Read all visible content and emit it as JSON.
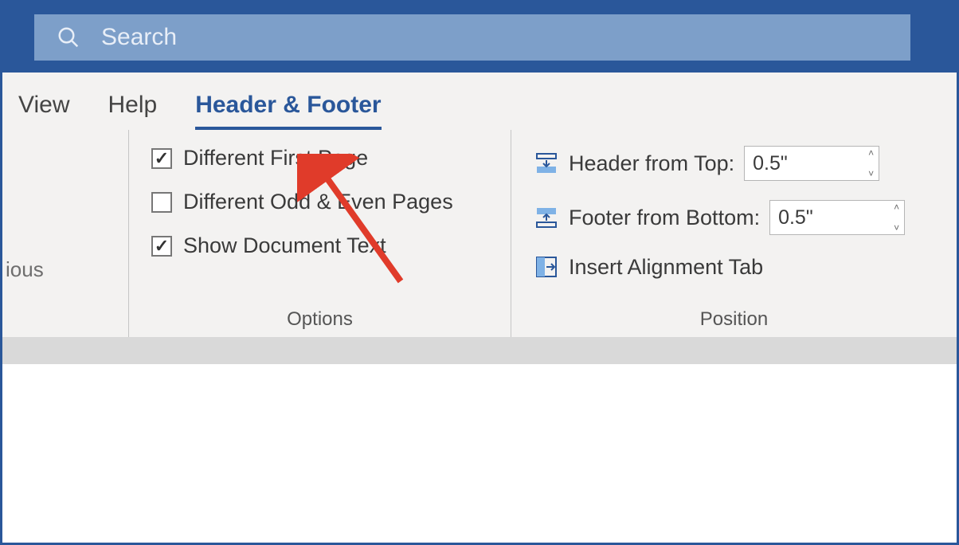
{
  "search": {
    "placeholder": "Search"
  },
  "tabs": {
    "view": "View",
    "help": "Help",
    "hf": "Header & Footer"
  },
  "prev_fragment": "ious",
  "options": {
    "diff_first": "Different First Page",
    "diff_odd_even": "Different Odd & Even Pages",
    "show_doc_text": "Show Document Text",
    "group": "Options"
  },
  "position": {
    "header_top_label": "Header from Top:",
    "header_top_value": "0.5\"",
    "footer_bottom_label": "Footer from Bottom:",
    "footer_bottom_value": "0.5\"",
    "align_tab": "Insert Alignment Tab",
    "group": "Position"
  }
}
